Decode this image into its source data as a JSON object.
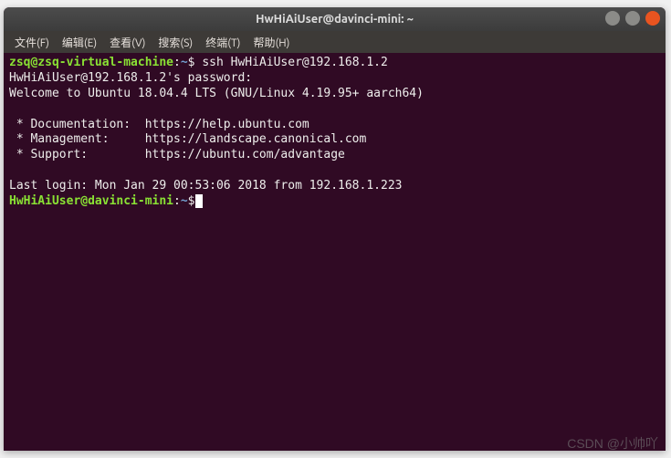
{
  "titlebar": {
    "title": "HwHiAiUser@davinci-mini: ~"
  },
  "menubar": {
    "items": [
      "文件(F)",
      "编辑(E)",
      "查看(V)",
      "搜索(S)",
      "终端(T)",
      "帮助(H)"
    ]
  },
  "terminal": {
    "prompt1_user": "zsq@zsq-virtual-machine",
    "prompt1_sep": ":",
    "prompt1_path": "~",
    "prompt1_dollar": "$ ",
    "command1": "ssh HwHiAiUser@192.168.1.2",
    "line2": "HwHiAiUser@192.168.1.2's password:",
    "line3": "Welcome to Ubuntu 18.04.4 LTS (GNU/Linux 4.19.95+ aarch64)",
    "blank1": "",
    "line5": " * Documentation:  https://help.ubuntu.com",
    "line6": " * Management:     https://landscape.canonical.com",
    "line7": " * Support:        https://ubuntu.com/advantage",
    "blank2": "",
    "line9": "Last login: Mon Jan 29 00:53:06 2018 from 192.168.1.223",
    "prompt2_user": "HwHiAiUser@davinci-mini",
    "prompt2_sep": ":",
    "prompt2_path": "~",
    "prompt2_dollar": "$"
  },
  "watermark": "CSDN @小帅吖"
}
